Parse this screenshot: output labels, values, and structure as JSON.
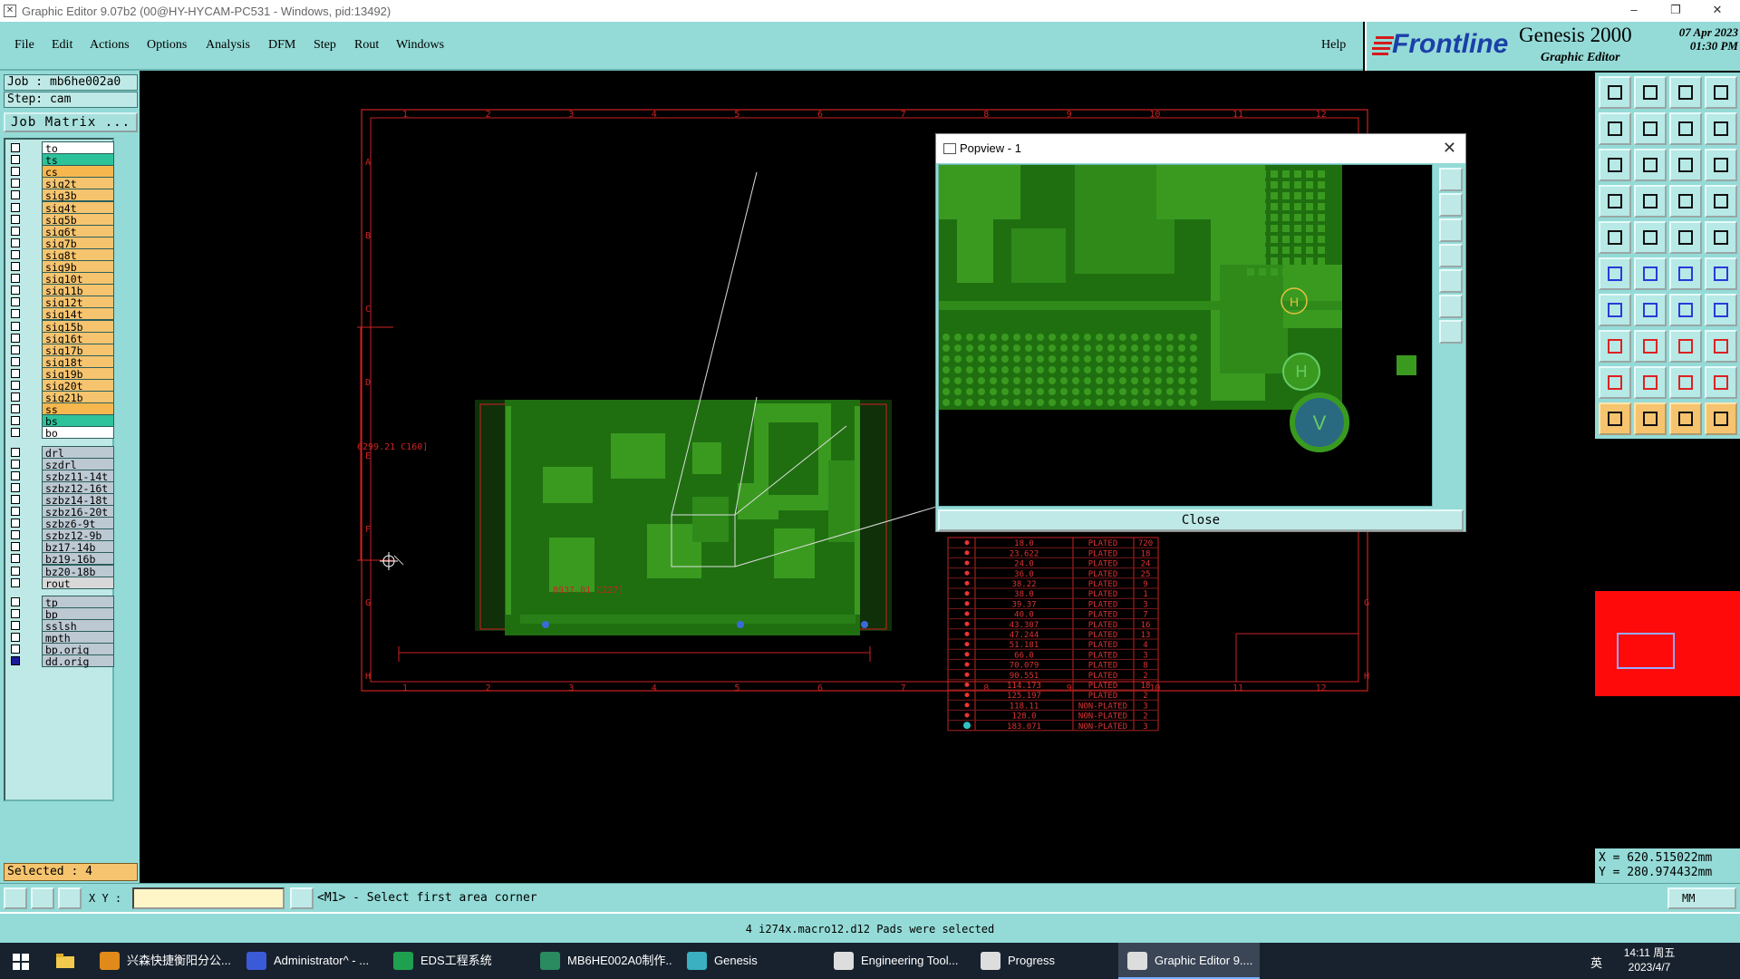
{
  "window": {
    "title": "Graphic Editor 9.07b2 (00@HY-HYCAM-PC531 - Windows, pid:13492)",
    "minimize": "–",
    "restore": "❐",
    "close": "✕"
  },
  "menu": {
    "items": [
      "File",
      "Edit",
      "Actions",
      "Options",
      "Analysis",
      "DFM",
      "Step",
      "Rout",
      "Windows"
    ],
    "help": "Help"
  },
  "brand": {
    "logo": "Frontline",
    "product": "Genesis 2000",
    "subtitle": "Graphic Editor",
    "date": "07 Apr 2023",
    "time": "01:30 PM"
  },
  "job": {
    "job_line": "Job : mb6he002a0",
    "step_line": "Step: cam",
    "matrix_button": "Job Matrix ..."
  },
  "layers": [
    {
      "name": "to",
      "color": "#ffffff",
      "checked": false
    },
    {
      "name": "ts",
      "color": "#2ec29a",
      "checked": false
    },
    {
      "name": "cs",
      "color": "#f6b84e",
      "checked": false
    },
    {
      "name": "sig2t",
      "color": "#f6c46e",
      "checked": false
    },
    {
      "name": "sig3b",
      "color": "#f6c46e",
      "checked": false
    },
    {
      "name": "sig4t",
      "color": "#f6c46e",
      "checked": false
    },
    {
      "name": "sig5b",
      "color": "#f6c46e",
      "checked": false
    },
    {
      "name": "sig6t",
      "color": "#f6c46e",
      "checked": false
    },
    {
      "name": "sig7b",
      "color": "#f6c46e",
      "checked": false
    },
    {
      "name": "sig8t",
      "color": "#f6c46e",
      "checked": false
    },
    {
      "name": "sig9b",
      "color": "#f6c46e",
      "checked": false
    },
    {
      "name": "sig10t",
      "color": "#f6c46e",
      "checked": false
    },
    {
      "name": "sig11b",
      "color": "#f6c46e",
      "checked": false
    },
    {
      "name": "sig12t",
      "color": "#f6c46e",
      "checked": false
    },
    {
      "name": "sig14t",
      "color": "#f6c46e",
      "checked": false
    },
    {
      "name": "sig15b",
      "color": "#f6c46e",
      "checked": false
    },
    {
      "name": "sig16t",
      "color": "#f6c46e",
      "checked": false
    },
    {
      "name": "sig17b",
      "color": "#f6c46e",
      "checked": false
    },
    {
      "name": "sig18t",
      "color": "#f6c46e",
      "checked": false
    },
    {
      "name": "sig19b",
      "color": "#f6c46e",
      "checked": false
    },
    {
      "name": "sig20t",
      "color": "#f6c46e",
      "checked": false
    },
    {
      "name": "sig21b",
      "color": "#f6c46e",
      "checked": false
    },
    {
      "name": "ss",
      "color": "#f6b84e",
      "checked": false
    },
    {
      "name": "bs",
      "color": "#2ec29a",
      "checked": false
    },
    {
      "name": "bo",
      "color": "#ffffff",
      "checked": false
    },
    {
      "name": "drl",
      "color": "#bcc8d2",
      "checked": false,
      "gap": true
    },
    {
      "name": "szdrl",
      "color": "#bcc8d2",
      "checked": false
    },
    {
      "name": "szbz11-14t",
      "color": "#bcc8d2",
      "checked": false
    },
    {
      "name": "szbz12-16t",
      "color": "#bcc8d2",
      "checked": false
    },
    {
      "name": "szbz14-18t",
      "color": "#bcc8d2",
      "checked": false
    },
    {
      "name": "szbz16-20t",
      "color": "#bcc8d2",
      "checked": false
    },
    {
      "name": "szbz6-9t",
      "color": "#bcc8d2",
      "checked": false
    },
    {
      "name": "szbz12-9b",
      "color": "#bcc8d2",
      "checked": false
    },
    {
      "name": "bz17-14b",
      "color": "#bcc8d2",
      "checked": false
    },
    {
      "name": "bz19-16b",
      "color": "#bcc8d2",
      "checked": false
    },
    {
      "name": "bz20-18b",
      "color": "#bcc8d2",
      "checked": false
    },
    {
      "name": "rout",
      "color": "#d8d8d8",
      "checked": false
    },
    {
      "name": "tp",
      "color": "#bcc8d2",
      "checked": false,
      "gap": true
    },
    {
      "name": "bp",
      "color": "#bcc8d2",
      "checked": false
    },
    {
      "name": "sslsh",
      "color": "#bcc8d2",
      "checked": false
    },
    {
      "name": "mpth",
      "color": "#bcc8d2",
      "checked": false
    },
    {
      "name": "bp.orig",
      "color": "#bcc8d2",
      "checked": false
    },
    {
      "name": "dd.orig",
      "color": "#bcc8d2",
      "checked": true
    }
  ],
  "selected_text": "Selected : 4",
  "board": {
    "width_label": "8937.01 C227]",
    "height_label": "6299.21 C160]",
    "col_marks": [
      "1",
      "2",
      "3",
      "4",
      "5",
      "6",
      "7",
      "8",
      "9",
      "10",
      "11",
      "12"
    ],
    "row_marks": [
      "A",
      "B",
      "C",
      "D",
      "E",
      "F",
      "G",
      "H"
    ]
  },
  "drill_table": [
    {
      "size": "18.0",
      "type": "PLATED",
      "count": "720"
    },
    {
      "size": "23.622",
      "type": "PLATED",
      "count": "18"
    },
    {
      "size": "24.0",
      "type": "PLATED",
      "count": "24"
    },
    {
      "size": "36.0",
      "type": "PLATED",
      "count": "25"
    },
    {
      "size": "38.22",
      "type": "PLATED",
      "count": "9"
    },
    {
      "size": "38.0",
      "type": "PLATED",
      "count": "1"
    },
    {
      "size": "39.37",
      "type": "PLATED",
      "count": "3"
    },
    {
      "size": "40.0",
      "type": "PLATED",
      "count": "7"
    },
    {
      "size": "43.307",
      "type": "PLATED",
      "count": "16"
    },
    {
      "size": "47.244",
      "type": "PLATED",
      "count": "13"
    },
    {
      "size": "51.181",
      "type": "PLATED",
      "count": "4"
    },
    {
      "size": "66.0",
      "type": "PLATED",
      "count": "3"
    },
    {
      "size": "70.079",
      "type": "PLATED",
      "count": "8"
    },
    {
      "size": "90.551",
      "type": "PLATED",
      "count": "2"
    },
    {
      "size": "114.173",
      "type": "PLATED",
      "count": "18"
    },
    {
      "size": "125.197",
      "type": "PLATED",
      "count": "2"
    },
    {
      "size": "118.11",
      "type": "NON-PLATED",
      "count": "3"
    },
    {
      "size": "128.0",
      "type": "NON-PLATED",
      "count": "2"
    },
    {
      "size": "183.071",
      "type": "NON-PLATED",
      "count": "3"
    }
  ],
  "popview": {
    "title": "Popview - 1",
    "close_button": "Close"
  },
  "coords": {
    "x": "X = 620.515022mm",
    "y": "Y = 280.974432mm"
  },
  "command": {
    "xy_label": "X Y :",
    "xy_value": "",
    "prompt": "<M1> - Select first area corner",
    "units": "MM"
  },
  "status": {
    "message": "4 i274x.macro12.d12 Pads were selected"
  },
  "taskbar": {
    "apps": [
      {
        "label": "兴森快捷衡阳分公...",
        "icon": "app-icon-orange"
      },
      {
        "label": "Administrator^ - ...",
        "icon": "app-icon-blue"
      },
      {
        "label": "EDS工程系统",
        "icon": "app-icon-green"
      },
      {
        "label": "MB6HE002A0制作...",
        "icon": "app-icon-doc"
      },
      {
        "label": "Genesis",
        "icon": "app-icon-genesis"
      },
      {
        "label": "Engineering Tool...",
        "icon": "app-icon-window"
      },
      {
        "label": "Progress",
        "icon": "app-icon-window"
      },
      {
        "label": "Graphic Editor 9....",
        "icon": "app-icon-window",
        "active": true
      }
    ],
    "ime": "英",
    "clock_time": "14:11 周五",
    "clock_date": "2023/4/7"
  }
}
